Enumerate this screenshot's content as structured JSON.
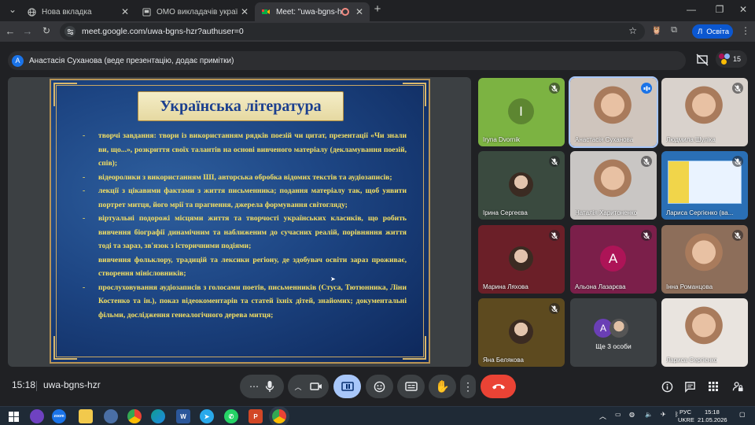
{
  "browser": {
    "tabs": [
      {
        "title": "Нова вкладка",
        "icon": "globe-icon"
      },
      {
        "title": "ОМО викладачів української м",
        "icon": "page-icon"
      },
      {
        "title": "Meet: \"uwa-bgns-hzr\"",
        "icon": "meet-icon",
        "active": true
      }
    ],
    "url": "meet.google.com/uwa-bgns-hzr?authuser=0",
    "profile": {
      "initial": "Л",
      "label": "Освіта"
    }
  },
  "meet": {
    "presenter_avatar": "А",
    "presenter_text": "Анастасія Суханова (веде презентацію, додає примітки)",
    "participant_count": "15",
    "meeting_code": "uwa-bgns-hzr",
    "time": "15:18"
  },
  "slide": {
    "title": "Українська література",
    "paragraphs": [
      {
        "text": "творчі завдання: твори із використанням рядків поезій чи цитат, презентації «Чи знали ви, що...», розкриття своїх талантів на основі вивченого матеріалу (декламування поезій, спів);",
        "bullet": true
      },
      {
        "text": "відеоролики з використанням ШІ, авторська обробка відомих текстів та аудіозаписів;",
        "bullet": true
      },
      {
        "text": "лекції з цікавими фактами з життя письменника; подання матеріалу так, щоб уявити портрет митця, його мрії та прагнення, джерела формування світогляду;",
        "bullet": true
      },
      {
        "text": "віртуальні подорожі місцями життя та творчості українських класиків, що робить вивчення біографії динамічним та наближеним до сучасних реалій, порівняння життя тоді та зараз, зв'язок з історичними подіями;",
        "bullet": true
      },
      {
        "text": "вивчення фольклору, традицій та лексики регіону, де здобувач освіти зараз проживає, створення мінісловників;",
        "bullet": false
      },
      {
        "text": "прослуховування аудіозаписів з голосами поетів, письменників (Стуса, Тютюнника, Ліни Костенко та ін.), показ відеокоментарів та статей їхніх дітей, знайомих; документальні фільми, дослідження генеалогічного дерева митця;",
        "bullet": true
      }
    ]
  },
  "participants": [
    {
      "name": "Iryna Dvornik",
      "initial": "I",
      "bg": "#7cb342",
      "type": "avatar",
      "mic": "muted"
    },
    {
      "name": "Анастасія Суханова",
      "bg": "#cfc5bd",
      "type": "photo",
      "mic": "speaking",
      "active": true
    },
    {
      "name": "Людмила Шуліка",
      "bg": "#d9d2cc",
      "type": "photo",
      "mic": "muted"
    },
    {
      "name": "Ірина Сергеєва",
      "bg": "#3a4a3f",
      "type": "small-photo",
      "mic": "muted"
    },
    {
      "name": "Наталія Харитоненко",
      "bg": "#c9c6c4",
      "type": "photo",
      "mic": "muted"
    },
    {
      "name": "Лариса Сергієнко (ва...",
      "bg": "#2a6fb5",
      "type": "screen",
      "mic": "muted"
    },
    {
      "name": "Марина Ляхова",
      "bg": "#6b1f28",
      "type": "small-photo",
      "mic": "muted"
    },
    {
      "name": "Альона Лазарєва",
      "initial": "А",
      "bg": "#7b1f4a",
      "avbg": "#ad1457",
      "type": "avatar",
      "mic": "muted"
    },
    {
      "name": "Інна Романцова",
      "bg": "#8d6e5a",
      "type": "photo",
      "mic": "muted"
    },
    {
      "name": "Яна Белякова",
      "bg": "#5d4a1f",
      "type": "small-photo",
      "mic": "muted"
    },
    {
      "name": "Ще 3 особи",
      "initial": "А",
      "bg": "#3c4043",
      "type": "more",
      "mic": "none"
    },
    {
      "name": "Лариса Сергієнко",
      "bg": "#e9e4df",
      "type": "photo",
      "mic": "none"
    }
  ],
  "taskbar": {
    "lang_top": "РУС",
    "lang_bottom": "UKRE",
    "time": "15:18",
    "date": "21.05.2026"
  },
  "colors": {
    "end_call": "#ea4335",
    "present_active": "#a8c7fa",
    "accent": "#1a73e8"
  }
}
